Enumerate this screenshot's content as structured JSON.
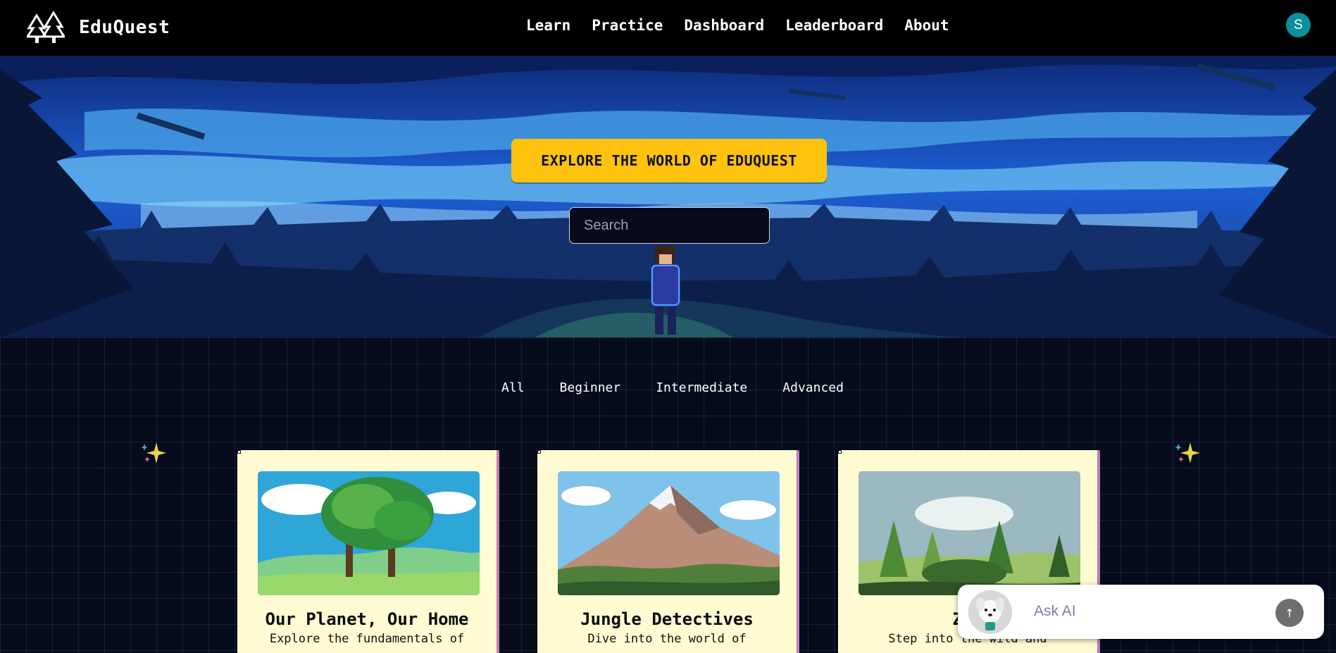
{
  "brand": {
    "name": "EduQuest",
    "logo_icon": "pine-trees-logo-icon"
  },
  "nav": {
    "links": [
      "Learn",
      "Practice",
      "Dashboard",
      "Leaderboard",
      "About"
    ]
  },
  "user": {
    "avatar_initial": "S",
    "avatar_color": "#0d8f9c"
  },
  "hero": {
    "banner_text": "EXPLORE THE WORLD OF EDUQUEST",
    "banner_color": "#ffc20e",
    "search_placeholder": "Search"
  },
  "filters": [
    "All",
    "Beginner",
    "Intermediate",
    "Advanced"
  ],
  "cards": [
    {
      "title": "Our Planet, Our Home",
      "description": "Explore the fundamentals of",
      "image_icon": "tree-landscape-image"
    },
    {
      "title": "Jungle Detectives",
      "description": "Dive into the world of",
      "image_icon": "mountain-landscape-image"
    },
    {
      "title": "Zoo",
      "description": "Step into the wild and",
      "image_icon": "forest-meadow-image"
    }
  ],
  "ask_ai": {
    "placeholder": "Ask AI",
    "send_icon": "arrow-up-icon",
    "avatar_icon": "dog-mascot-icon"
  }
}
